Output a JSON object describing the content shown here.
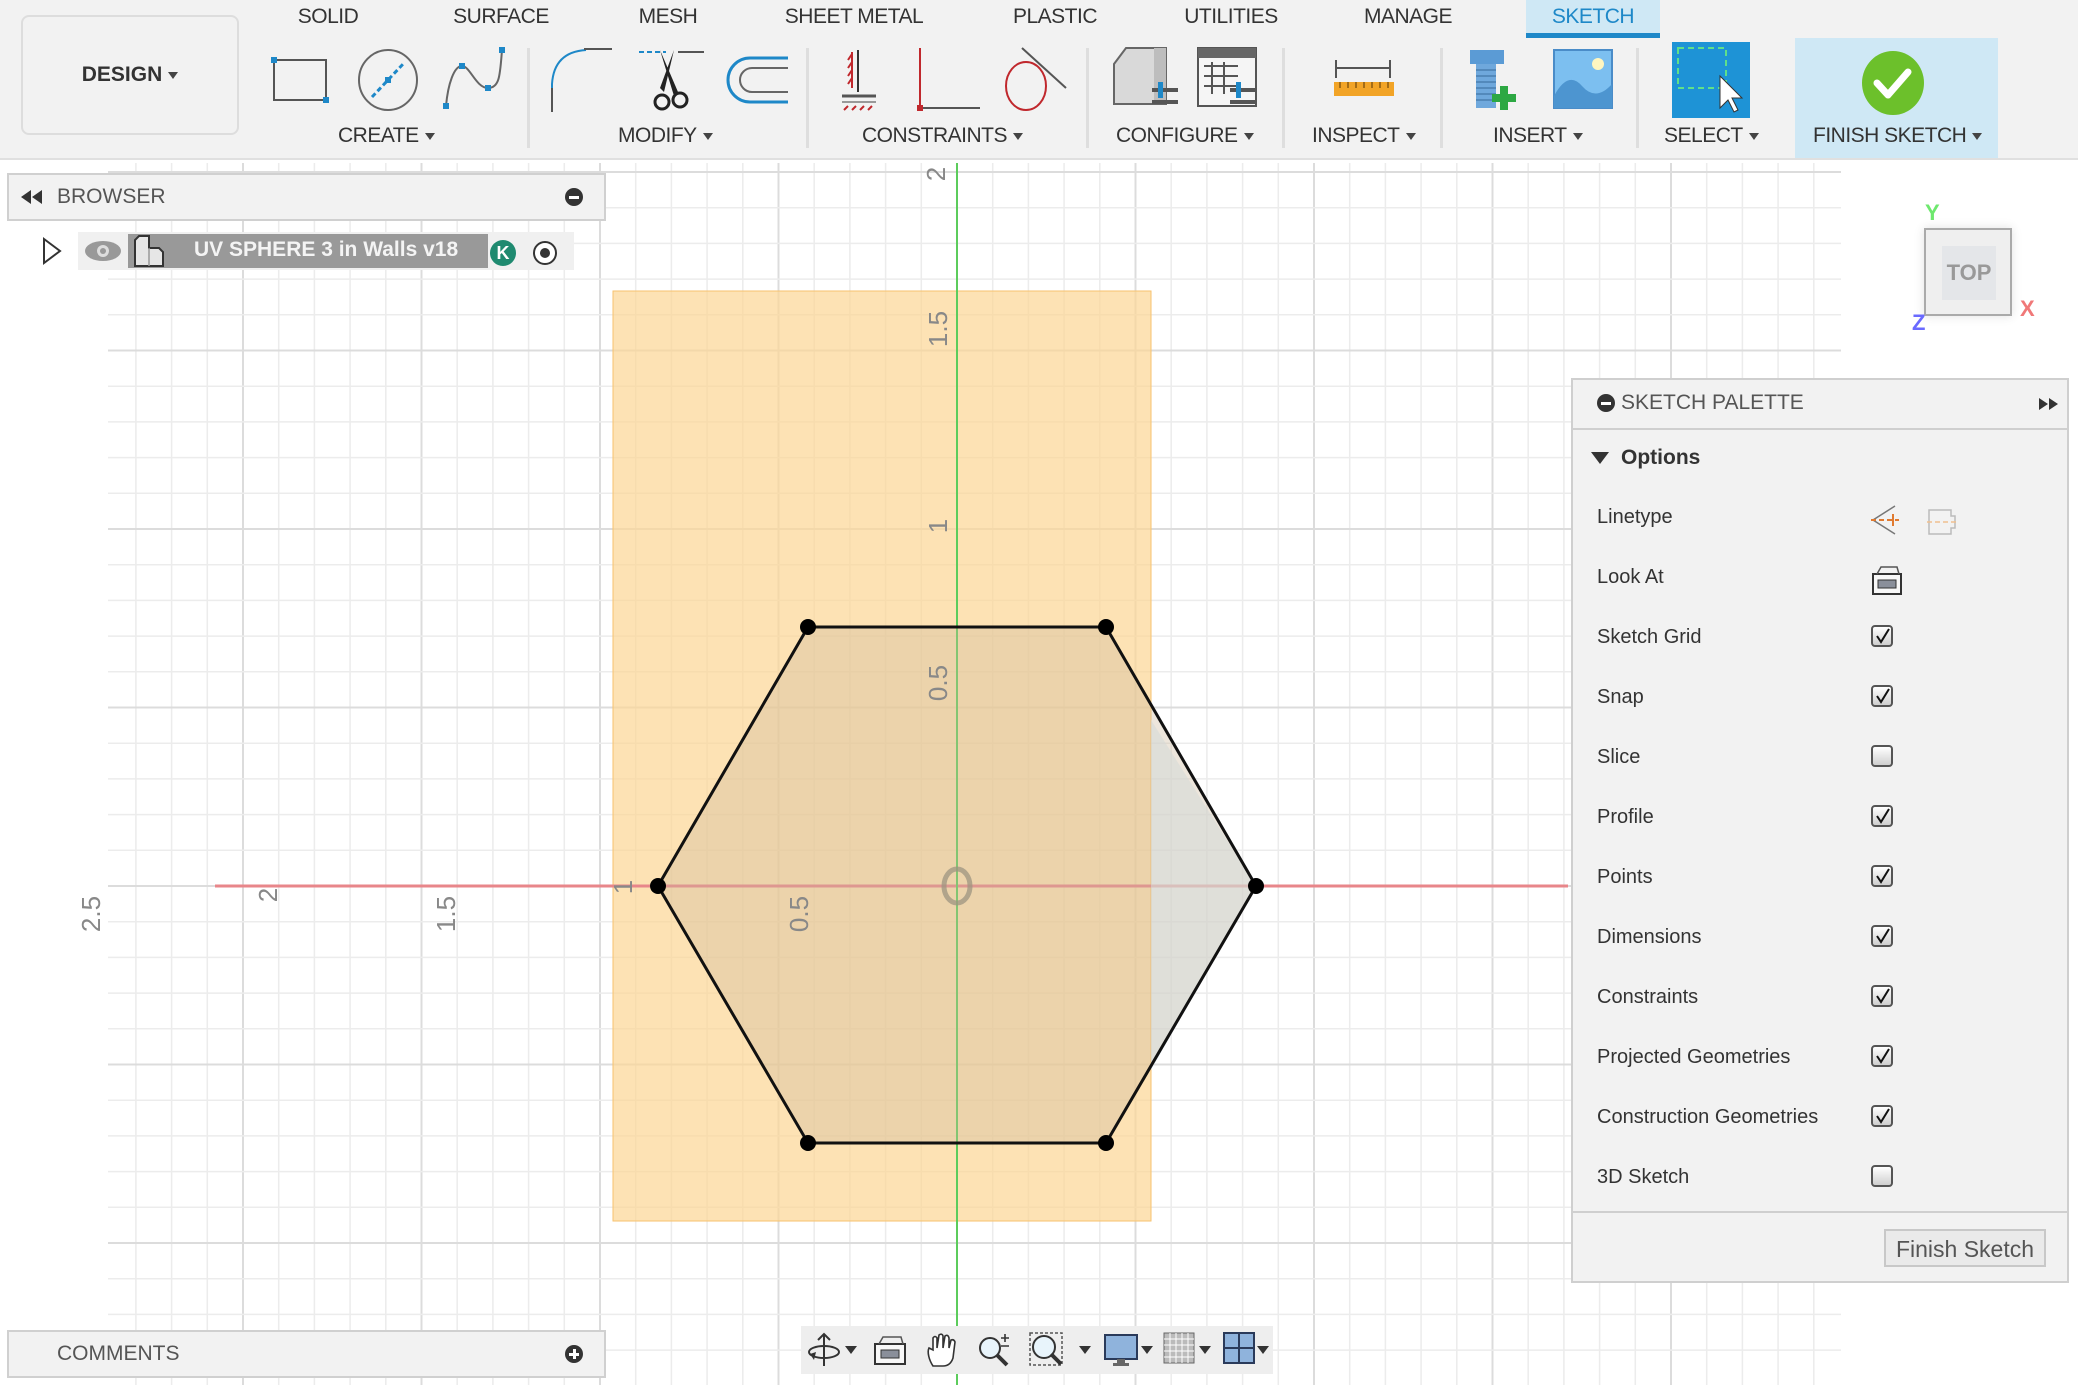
{
  "toolbar": {
    "workspace": "DESIGN",
    "tabs": [
      {
        "label": "SOLID",
        "active": false
      },
      {
        "label": "SURFACE",
        "active": false
      },
      {
        "label": "MESH",
        "active": false
      },
      {
        "label": "SHEET METAL",
        "active": false
      },
      {
        "label": "PLASTIC",
        "active": false
      },
      {
        "label": "UTILITIES",
        "active": false
      },
      {
        "label": "MANAGE",
        "active": false
      },
      {
        "label": "SKETCH",
        "active": true
      }
    ],
    "groups": {
      "create": "CREATE",
      "modify": "MODIFY",
      "constraints": "CONSTRAINTS",
      "configure": "CONFIGURE",
      "inspect": "INSPECT",
      "insert": "INSERT",
      "select": "SELECT",
      "finish": "FINISH SKETCH"
    },
    "colors": {
      "accent": "#1e88c8",
      "active_bg": "#cfe8f5",
      "finish_green": "#6cc02b"
    }
  },
  "browser": {
    "title": "BROWSER",
    "document_name": "UV SPHERE 3 in Walls v18",
    "user_badge": "K"
  },
  "comments": {
    "title": "COMMENTS"
  },
  "viewcube": {
    "face": "TOP",
    "x": "X",
    "y": "Y",
    "z": "Z"
  },
  "canvas": {
    "vertical_axis_labels": [
      "2",
      "1.5",
      "1",
      "0.5"
    ],
    "horizontal_axis_labels": [
      "2.5",
      "2",
      "1.5",
      "1",
      "0.5"
    ],
    "colors": {
      "x_axis": "#e8868a",
      "y_axis": "#5ccc5c",
      "profile_fill": "#fcd9a0",
      "sketch_line": "#111111"
    }
  },
  "sketch_palette": {
    "title": "SKETCH PALETTE",
    "section": "Options",
    "linetype_label": "Linetype",
    "look_at_label": "Look At",
    "options": [
      {
        "label": "Sketch Grid",
        "checked": true
      },
      {
        "label": "Snap",
        "checked": true
      },
      {
        "label": "Slice",
        "checked": false
      },
      {
        "label": "Profile",
        "checked": true
      },
      {
        "label": "Points",
        "checked": true
      },
      {
        "label": "Dimensions",
        "checked": true
      },
      {
        "label": "Constraints",
        "checked": true
      },
      {
        "label": "Projected Geometries",
        "checked": true
      },
      {
        "label": "Construction Geometries",
        "checked": true
      },
      {
        "label": "3D Sketch",
        "checked": false
      }
    ],
    "finish_button": "Finish Sketch"
  }
}
